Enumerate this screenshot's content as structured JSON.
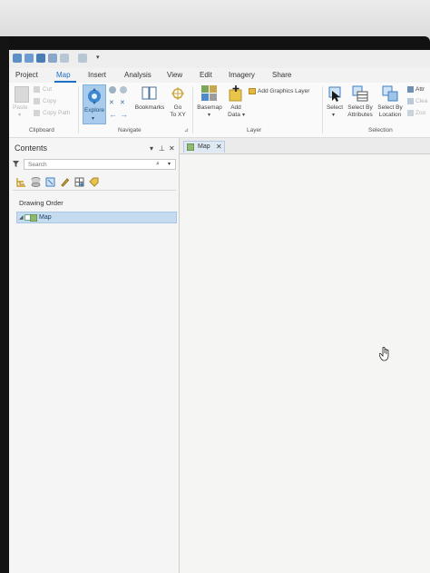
{
  "tabs": [
    "Project",
    "Map",
    "Insert",
    "Analysis",
    "View",
    "Edit",
    "Imagery",
    "Share"
  ],
  "active_tab": "Map",
  "ribbon": {
    "clipboard": {
      "paste": "Paste",
      "cut": "Cut",
      "copy": "Copy",
      "copy_path": "Copy Path",
      "group_label": "Clipboard"
    },
    "navigate": {
      "explore": "Explore",
      "bookmarks": "Bookmarks",
      "go_to_xy_line1": "Go",
      "go_to_xy_line2": "To XY",
      "group_label": "Navigate"
    },
    "layer": {
      "basemap": "Basemap",
      "add_data_line1": "Add",
      "add_data_line2": "Data",
      "add_graphics_layer": "Add Graphics Layer",
      "group_label": "Layer"
    },
    "selection": {
      "select": "Select",
      "select_by_attributes_line1": "Select By",
      "select_by_attributes_line2": "Attributes",
      "select_by_location_line1": "Select By",
      "select_by_location_line2": "Location",
      "attributes": "Attr",
      "clear": "Clea",
      "zoom": "Zoo",
      "group_label": "Selection"
    }
  },
  "contents": {
    "title": "Contents",
    "search_placeholder": "Search",
    "drawing_order": "Drawing Order",
    "map_item": "Map"
  },
  "map_view": {
    "tab_label": "Map"
  },
  "colors": {
    "accent": "#1b6fc7",
    "selected_row": "#c5dcf0"
  }
}
